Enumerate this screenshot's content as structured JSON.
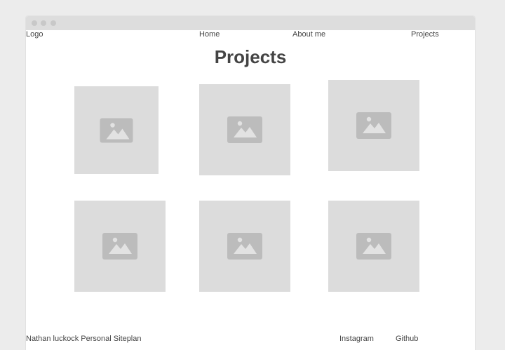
{
  "nav": {
    "logo": "Logo",
    "home": "Home",
    "about": "About me",
    "projects": "Projects"
  },
  "page": {
    "title": "Projects"
  },
  "gallery": {
    "items": [
      {
        "icon": "image-placeholder-icon"
      },
      {
        "icon": "image-placeholder-icon"
      },
      {
        "icon": "image-placeholder-icon"
      },
      {
        "icon": "image-placeholder-icon"
      },
      {
        "icon": "image-placeholder-icon"
      },
      {
        "icon": "image-placeholder-icon"
      }
    ]
  },
  "footer": {
    "site_label": "Nathan luckock Personal Siteplan",
    "instagram": "Instagram",
    "github": "Github"
  },
  "colors": {
    "background": "#ececec",
    "window": "#ffffff",
    "titlebar": "#dddddd",
    "placeholder": "#dcdcdc",
    "icon": "#bcbcbc",
    "text": "#444444"
  }
}
